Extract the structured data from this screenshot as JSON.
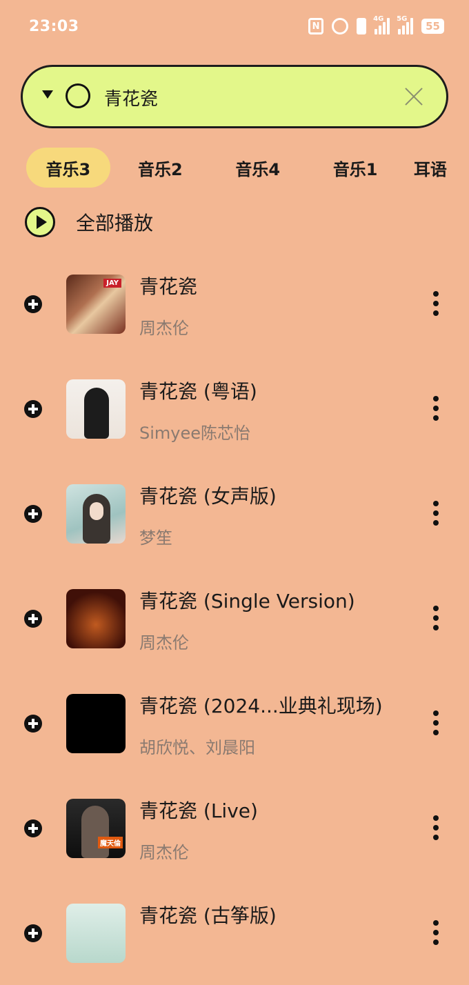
{
  "status_bar": {
    "time": "23:03",
    "battery": "55",
    "network_1": "4G",
    "network_2": "5G"
  },
  "search": {
    "query": "青花瓷"
  },
  "tabs": [
    {
      "label": "音乐3",
      "active": true
    },
    {
      "label": "音乐2",
      "active": false
    },
    {
      "label": "音乐4",
      "active": false
    },
    {
      "label": "音乐1",
      "active": false
    },
    {
      "label": "耳语",
      "active": false
    }
  ],
  "play_all": {
    "label": "全部播放"
  },
  "songs": [
    {
      "title": "青花瓷",
      "artist": "周杰伦",
      "cover_badge": "JAY"
    },
    {
      "title": "青花瓷 (粤语)",
      "artist": "Simyee陈芯怡"
    },
    {
      "title": "青花瓷 (女声版)",
      "artist": "梦笙"
    },
    {
      "title": "青花瓷 (Single Version)",
      "artist": "周杰伦"
    },
    {
      "title": "青花瓷 (2024...业典礼现场)",
      "artist": "胡欣悦、刘晨阳"
    },
    {
      "title": "青花瓷 (Live)",
      "artist": "周杰伦",
      "cover_badge": "魔天倫"
    },
    {
      "title": "青花瓷 (古筝版)",
      "artist": ""
    }
  ],
  "colors": {
    "background": "#f3b793",
    "search_bg": "#e3f78a",
    "active_tab_bg": "#f7d97c",
    "artist_text": "#8a7a70"
  },
  "icons": [
    "nfc-icon",
    "alarm-icon",
    "vibrate-icon",
    "signal-icon",
    "battery-icon",
    "dropdown-icon",
    "circle-icon",
    "clear-icon",
    "play-icon",
    "add-icon",
    "more-icon"
  ]
}
